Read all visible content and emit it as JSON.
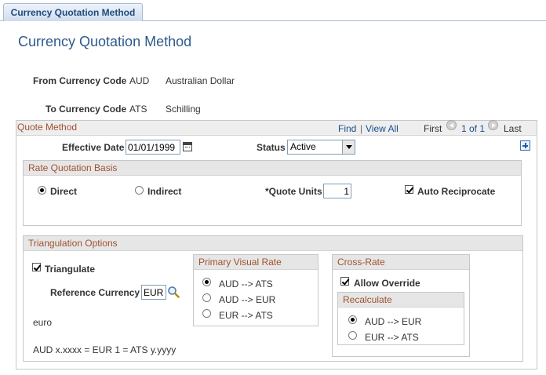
{
  "tab": {
    "label": "Currency Quotation Method"
  },
  "page": {
    "title": "Currency Quotation Method"
  },
  "from_currency": {
    "label": "From Currency Code",
    "code": "AUD",
    "name": "Australian Dollar"
  },
  "to_currency": {
    "label": "To Currency Code",
    "code": "ATS",
    "name": "Schilling"
  },
  "quote_method": {
    "title": "Quote Method",
    "nav": {
      "find": "Find",
      "separator": "|",
      "view_all": "View All",
      "first": "First",
      "count": "1 of 1",
      "last": "Last"
    },
    "effective_date": {
      "label": "Effective Date",
      "value": "01/01/1999"
    },
    "status": {
      "label": "Status",
      "value": "Active"
    }
  },
  "rate_quotation_basis": {
    "title": "Rate Quotation Basis",
    "direct": "Direct",
    "indirect": "Indirect",
    "selected": "Direct",
    "quote_units": {
      "label": "*Quote Units",
      "value": "1"
    },
    "auto_reciprocate": {
      "label": "Auto Reciprocate",
      "checked": true
    }
  },
  "triangulation": {
    "title": "Triangulation Options",
    "triangulate": {
      "label": "Triangulate",
      "checked": true
    },
    "reference_currency": {
      "label": "Reference Currency",
      "value": "EUR",
      "description": "euro"
    },
    "formula": "AUD x.xxxx = EUR 1 = ATS y.yyyy",
    "primary_visual_rate": {
      "title": "Primary Visual Rate",
      "options": [
        "AUD --> ATS",
        "AUD --> EUR",
        "EUR --> ATS"
      ],
      "selected_index": 0
    },
    "cross_rate": {
      "title": "Cross-Rate",
      "allow_override": {
        "label": "Allow Override",
        "checked": true
      },
      "recalculate": {
        "title": "Recalculate",
        "options": [
          "AUD --> EUR",
          "EUR --> ATS"
        ],
        "selected_index": 0
      }
    }
  }
}
